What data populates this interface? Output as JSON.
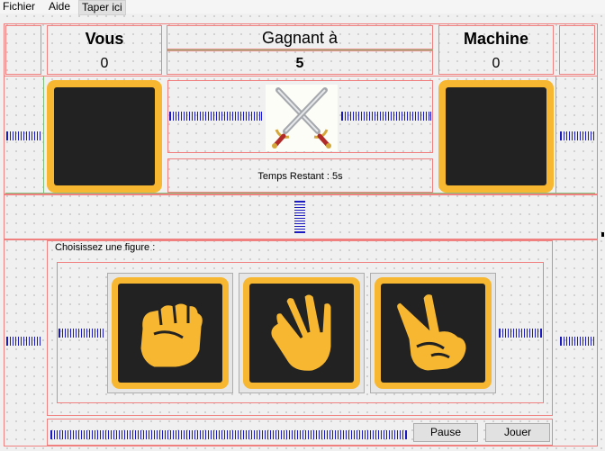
{
  "menu": {
    "file": "Fichier",
    "help": "Aide",
    "type_here": "Taper ici"
  },
  "player": {
    "title": "Vous",
    "score": "0"
  },
  "target": {
    "title": "Gagnant à",
    "score": "5"
  },
  "machine": {
    "title": "Machine",
    "score": "0"
  },
  "timer": {
    "text": "Temps Restant : 5s"
  },
  "choices": {
    "label": "Choisissez une figure :",
    "items": [
      {
        "name": "rock",
        "icon": "fist-icon"
      },
      {
        "name": "paper",
        "icon": "open-hand-icon"
      },
      {
        "name": "scissors",
        "icon": "victory-hand-icon"
      }
    ]
  },
  "buttons": {
    "pause": "Pause",
    "play": "Jouer"
  },
  "colors": {
    "tile_accent": "#f7b731",
    "tile_fill": "#222222",
    "layout_border": "#f08080",
    "spacer": "#1a1ac0"
  }
}
